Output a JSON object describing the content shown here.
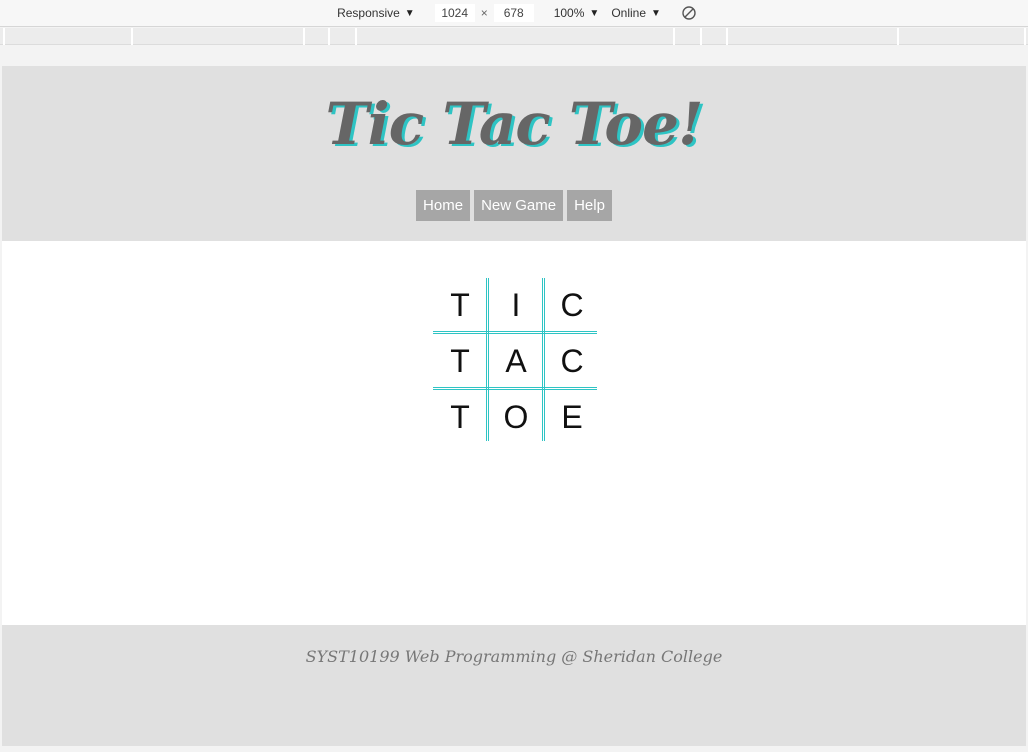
{
  "devtools": {
    "device_label": "Responsive",
    "width_value": "1024",
    "separator": "×",
    "height_value": "678",
    "zoom_label": "100%",
    "network_label": "Online",
    "rotate_icon": "rotate-disabled-icon"
  },
  "site": {
    "title": "Tic Tac Toe!",
    "nav": [
      "Home",
      "New Game",
      "Help"
    ],
    "board": [
      "T",
      "I",
      "C",
      "T",
      "A",
      "C",
      "T",
      "O",
      "E"
    ],
    "footer": "SYST10199 Web Programming @ Sheridan College"
  },
  "colors": {
    "accent": "#2ec4c4",
    "header_bg": "#e0e0e0",
    "nav_bg": "#a6a6a6",
    "title": "#666666"
  }
}
